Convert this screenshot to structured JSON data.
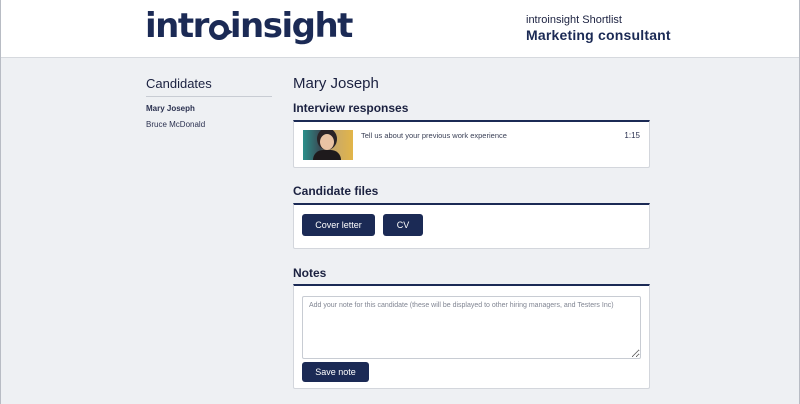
{
  "header": {
    "logo_text_left": "intr",
    "logo_text_right": "insight",
    "shortlist_label": "introinsight Shortlist",
    "role_title": "Marketing consultant"
  },
  "sidebar": {
    "title": "Candidates",
    "candidates": [
      {
        "name": "Mary Joseph",
        "active": true
      },
      {
        "name": "Bruce McDonald",
        "active": false
      }
    ]
  },
  "main": {
    "candidate_name": "Mary Joseph",
    "interview": {
      "title": "Interview responses",
      "responses": [
        {
          "question": "Tell us about your previous work experience",
          "duration": "1:15"
        }
      ]
    },
    "files": {
      "title": "Candidate files",
      "buttons": [
        "Cover letter",
        "CV"
      ]
    },
    "notes": {
      "title": "Notes",
      "placeholder": "Add your note for this candidate (these will be displayed to other hiring managers, and Testers Inc)",
      "value": "",
      "save_label": "Save note"
    }
  },
  "colors": {
    "brand": "#1b2a55",
    "background": "#eef0f3"
  }
}
